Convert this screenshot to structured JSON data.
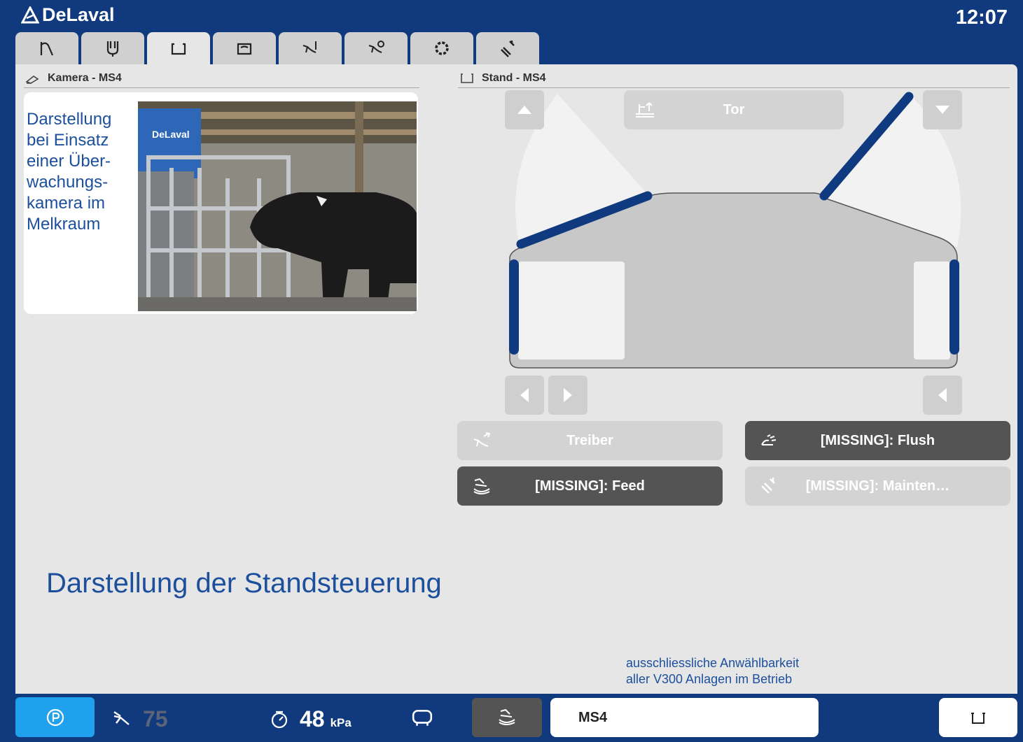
{
  "header": {
    "logo_text": "DeLaval",
    "time": "12:07",
    "tabs": [
      {
        "icon": "stall-icon",
        "active": false
      },
      {
        "icon": "milking-unit-icon",
        "active": false
      },
      {
        "icon": "stand-icon",
        "active": true
      },
      {
        "icon": "wash-icon",
        "active": false
      },
      {
        "icon": "cow-entry-icon",
        "active": false
      },
      {
        "icon": "cow-exit-icon",
        "active": false
      },
      {
        "icon": "settings-gear-icon",
        "active": false
      },
      {
        "icon": "service-tools-icon",
        "active": false
      }
    ]
  },
  "camera": {
    "title": "Kamera - MS4",
    "note": "Darstellung bei Einsatz einer Über-wachungs-kamera im Melkraum",
    "photo_brand": "DeLaval"
  },
  "stand": {
    "title": "Stand - MS4",
    "gate_label": "Tor",
    "actions": {
      "driver": "Treiber",
      "flush": "[MISSING]: Flush",
      "feed": "[MISSING]: Feed",
      "maintenance": "[MISSING]: Mainten…"
    }
  },
  "annotations": {
    "big_title": "Darstellung der Standsteuerung",
    "footnote_line1": "ausschliessliche Anwählbarkeit",
    "footnote_line2": "aller V300 Anlagen im Betrieb"
  },
  "bottom": {
    "cow_count": "75",
    "vacuum_value": "48",
    "vacuum_unit": "kPa",
    "station": "MS4"
  },
  "colors": {
    "brand_blue": "#113a7e",
    "accent_blue": "#1fa1ee",
    "text_blue": "#1c4f9c",
    "gate_blue": "#103a80",
    "dark_button": "#545454"
  }
}
